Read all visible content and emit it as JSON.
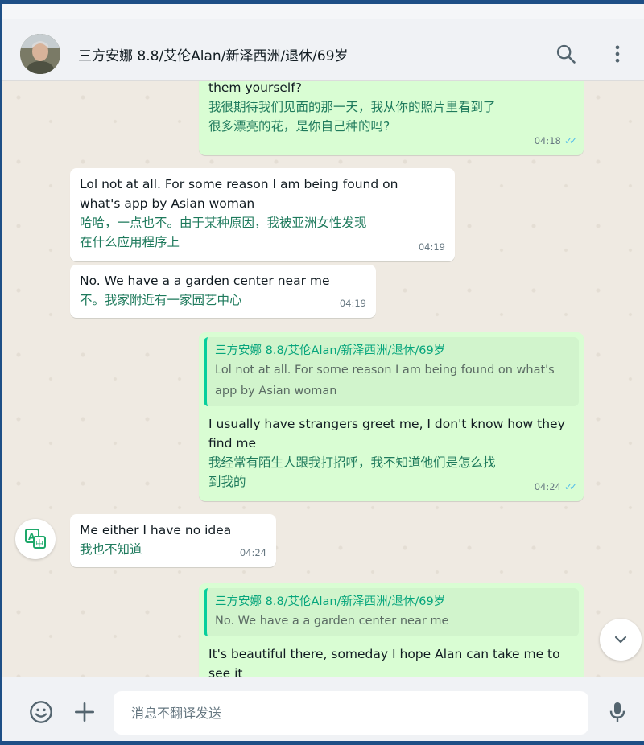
{
  "header": {
    "contact_name": "三方安娜 8.8/艾伦Alan/新泽西洲/退休/69岁",
    "avatar_icon": "person-avatar",
    "search_icon": "search-icon",
    "menu_icon": "more-vertical-icon"
  },
  "messages": [
    {
      "direction": "out",
      "en": "them yourself?",
      "zh": "我很期待我们见面的那一天，我从你的照片里看到了很多漂亮的花，是你自己种的吗?",
      "zh_lines": [
        "我很期待我们见面的那一天，我从你的照片里看到了",
        "很多漂亮的花，是你自己种的吗?"
      ],
      "time": "04:18",
      "status": "read"
    },
    {
      "direction": "in",
      "en_lines": [
        "Lol not at all. For some reason I am being found on",
        "what's app by Asian woman"
      ],
      "zh_lines": [
        "哈哈，一点也不。由于某种原因，我被亚洲女性发现",
        "在什么应用程序上"
      ],
      "time": "04:19"
    },
    {
      "direction": "in",
      "en": "No. We have a a garden center near me",
      "zh": "不。我家附近有一家园艺中心",
      "time": "04:19"
    },
    {
      "direction": "out",
      "quote_name": "三方安娜 8.8/艾伦Alan/新泽西洲/退休/69岁",
      "quote_lines": [
        "Lol not at all. For some reason I am being found on what's",
        "app by Asian woman"
      ],
      "en_lines": [
        "I usually have strangers greet me, I don't know how they",
        "find me"
      ],
      "zh_lines": [
        "我经常有陌生人跟我打招呼，我不知道他们是怎么找",
        "到我的"
      ],
      "time": "04:24",
      "status": "read"
    },
    {
      "direction": "in",
      "en": "Me either I have no idea",
      "zh": "我也不知道",
      "time": "04:24"
    },
    {
      "direction": "out",
      "quote_name": "三方安娜 8.8/艾伦Alan/新泽西洲/退休/69岁",
      "quote_text": "No. We have a a garden center near me",
      "en_lines": [
        "It's beautiful there, someday I hope Alan can take me to",
        "see it"
      ]
    }
  ],
  "controls": {
    "translate_icon": "translate-icon",
    "scroll_down_icon": "chevron-down-icon"
  },
  "footer": {
    "emoji_icon": "emoji-icon",
    "attach_icon": "plus-icon",
    "input_placeholder": "消息不翻译发送",
    "mic_icon": "microphone-icon"
  },
  "colors": {
    "chat_bg": "#efeae2",
    "outgoing_bubble": "#d9fdd3",
    "incoming_bubble": "#ffffff",
    "translation_text": "#1e7a5c",
    "quote_accent": "#06cf9c",
    "read_ticks": "#53bdeb",
    "window_frame": "#1e4f86"
  }
}
